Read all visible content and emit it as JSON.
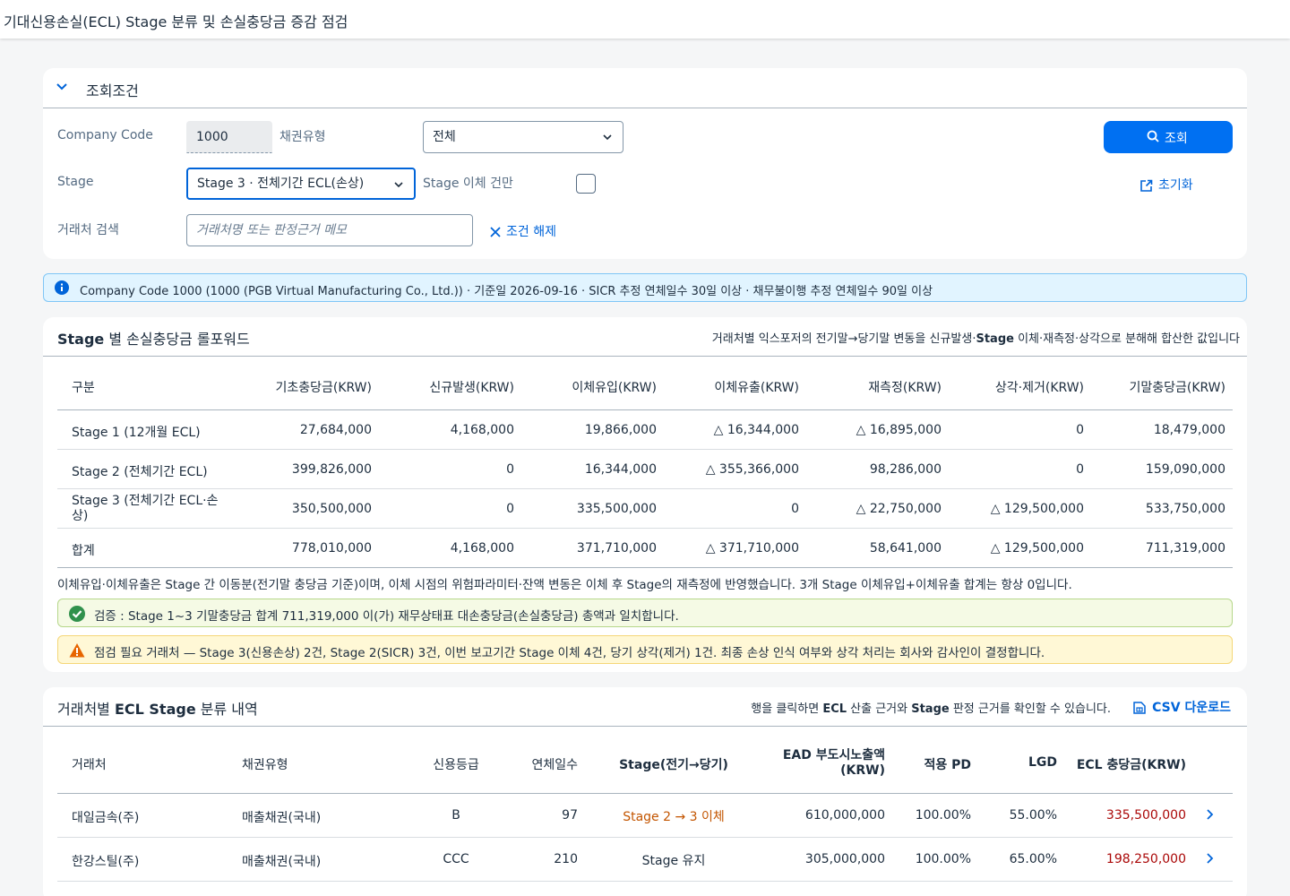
{
  "shell": {
    "title": "기대신용손실(ECL) Stage 분류 및 손실충당금 증감 점검"
  },
  "filter": {
    "title": "조회조건",
    "company_code_label": "Company Code",
    "company_code_value": "1000",
    "receivable_type_label": "채권유형",
    "receivable_type_value": "전체",
    "stage_label": "Stage",
    "stage_value": "Stage 3 · 전체기간 ECL(손상)",
    "transfer_only_label": "Stage 이체 건만",
    "search_label": "거래처 검색",
    "search_placeholder": "거래처명 또는 판정근거 메모",
    "clear_label": "조건 해제",
    "query_button": "조회",
    "reset_label": "초기화"
  },
  "info": {
    "text": "Company Code 1000 (1000 (PGB Virtual Manufacturing Co., Ltd.)) · 기준일 2026-09-16 · SICR 추정 연체일수 30일 이상 · 채무불이행 추정 연체일수 90일 이상"
  },
  "rollforward": {
    "title_bold": "Stage",
    "title_rest": " 별 손실충당금 롤포워드",
    "subtitle_a": "거래처별 익스포저의 전기말→당기말 변동을 신규발생·",
    "subtitle_bold": "Stage",
    "subtitle_b": " 이체·재측정·상각으로 분해해 합산한 값입니다",
    "columns": [
      "구분",
      "기초충당금(KRW)",
      "신규발생(KRW)",
      "이체유입(KRW)",
      "이체유출(KRW)",
      "재측정(KRW)",
      "상각·제거(KRW)",
      "기말충당금(KRW)"
    ],
    "rows": [
      [
        "Stage 1 (12개월 ECL)",
        "27,684,000",
        "4,168,000",
        "19,866,000",
        "△ 16,344,000",
        "△ 16,895,000",
        "0",
        "18,479,000"
      ],
      [
        "Stage 2 (전체기간 ECL)",
        "399,826,000",
        "0",
        "16,344,000",
        "△ 355,366,000",
        "98,286,000",
        "0",
        "159,090,000"
      ],
      [
        "Stage 3 (전체기간 ECL·손상)",
        "350,500,000",
        "0",
        "335,500,000",
        "0",
        "△ 22,750,000",
        "△ 129,500,000",
        "533,750,000"
      ],
      [
        "합계",
        "778,010,000",
        "4,168,000",
        "371,710,000",
        "△ 371,710,000",
        "58,641,000",
        "△ 129,500,000",
        "711,319,000"
      ]
    ],
    "note": "이체유입·이체유출은 Stage 간 이동분(전기말 충당금 기준)이며, 이체 시점의 위험파라미터·잔액 변동은 이체 후 Stage의 재측정에 반영했습니다. 3개 Stage 이체유입+이체유출 합계는 항상 0입니다.",
    "success": "검증 : Stage 1~3 기말충당금 합계 711,319,000 이(가) 재무상태표 대손충당금(손실충당금) 총액과 일치합니다.",
    "warning": "점검 필요 거래처 — Stage 3(신용손상) 2건, Stage 2(SICR) 3건, 이번 보고기간 Stage 이체 4건, 당기 상각(제거) 1건. 최종 손상 인식 여부와 상각 처리는 회사와 감사인이 결정합니다."
  },
  "detail": {
    "title_a": "거래처별 ",
    "title_bold": "ECL Stage",
    "title_b": " 분류 내역",
    "hint_a": "행을 클릭하면 ",
    "hint_b1": "ECL",
    "hint_c": " 산출 근거와 ",
    "hint_b2": "Stage",
    "hint_d": " 판정 근거를 확인할 수 있습니다.",
    "csv_label": "CSV 다운로드",
    "columns": [
      "거래처",
      "채권유형",
      "신용등급",
      "연체일수",
      "Stage(전기→당기)",
      "EAD 부도시노출액 (KRW)",
      "적용 PD",
      "LGD",
      "ECL 충당금(KRW)"
    ],
    "rows": [
      [
        "대일금속(주)",
        "매출채권(국내)",
        "B",
        "97",
        "Stage 2 → 3 이체",
        "610,000,000",
        "100.00%",
        "55.00%",
        "335,500,000"
      ],
      [
        "한강스틸(주)",
        "매출채권(국내)",
        "CCC",
        "210",
        "Stage 유지",
        "305,000,000",
        "100.00%",
        "65.00%",
        "198,250,000"
      ]
    ]
  }
}
